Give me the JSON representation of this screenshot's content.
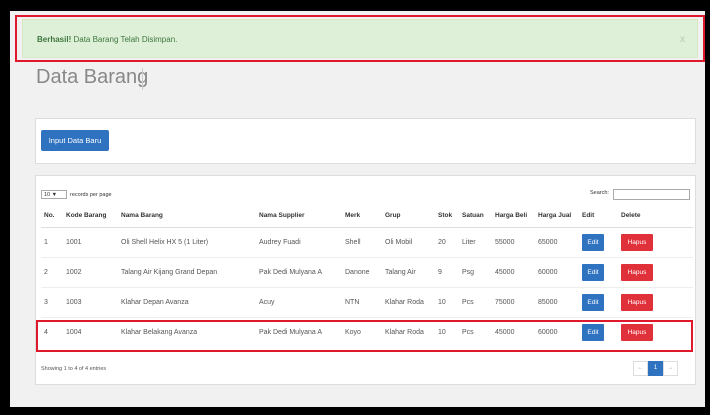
{
  "alert": {
    "strong": "Berhasil!",
    "message": "Data Barang Telah Disimpan.",
    "close": "x"
  },
  "page_title": "Data Barang",
  "input_button": "Input Data Baru",
  "table_controls": {
    "length_value": "10",
    "length_label": "records per page",
    "search_label": "Search:"
  },
  "columns": [
    "No.",
    "Kode Barang",
    "Nama Barang",
    "Nama Supplier",
    "Merk",
    "Grup",
    "Stok",
    "Satuan",
    "Harga Beli",
    "Harga Jual",
    "Edit",
    "Delete"
  ],
  "rows": [
    {
      "no": "1",
      "kode": "1001",
      "nama": "Oli Shell Helix HX 5 (1 Liter)",
      "supplier": "Audrey Fuadi",
      "merk": "Shell",
      "grup": "Oli Mobil",
      "stok": "20",
      "satuan": "Liter",
      "beli": "55000",
      "jual": "65000"
    },
    {
      "no": "2",
      "kode": "1002",
      "nama": "Talang Air Kijang Grand Depan",
      "supplier": "Pak Dedi Mulyana A",
      "merk": "Danone",
      "grup": "Talang Air",
      "stok": "9",
      "satuan": "Psg",
      "beli": "45000",
      "jual": "60000"
    },
    {
      "no": "3",
      "kode": "1003",
      "nama": "Klahar Depan Avanza",
      "supplier": "Acuy",
      "merk": "NTN",
      "grup": "Klahar Roda",
      "stok": "10",
      "satuan": "Pcs",
      "beli": "75000",
      "jual": "85000"
    },
    {
      "no": "4",
      "kode": "1004",
      "nama": "Klahar Belakang Avanza",
      "supplier": "Pak Dedi Mulyana A",
      "merk": "Koyo",
      "grup": "Klahar Roda",
      "stok": "10",
      "satuan": "Pcs",
      "beli": "45000",
      "jual": "60000"
    }
  ],
  "row_buttons": {
    "edit": "Edit",
    "delete": "Hapus"
  },
  "footer": {
    "info": "Showing 1 to 4 of 4 entries",
    "prev": "←",
    "page": "1",
    "next": "→"
  },
  "colors": {
    "primary": "#2f72c0",
    "danger": "#e0303a",
    "success_bg": "#dff0d8",
    "highlight": "#e0182b"
  }
}
